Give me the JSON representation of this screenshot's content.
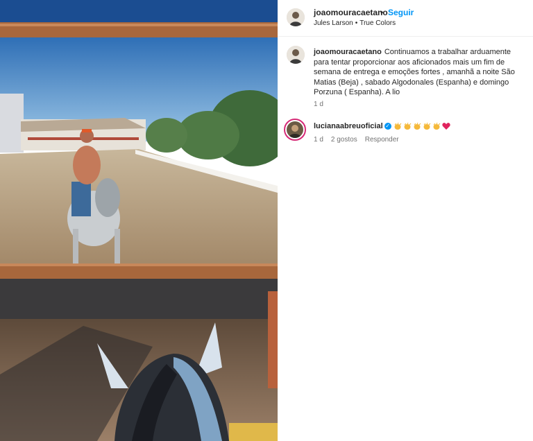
{
  "post": {
    "username": "joaomouracaetano",
    "separator": "•",
    "follow_label": "Seguir",
    "audio_artist": "Jules Larson",
    "audio_separator": "•",
    "audio_track": "True Colors"
  },
  "caption": {
    "username": "joaomouracaetano",
    "text": "Continuamos a trabalhar arduamente para tentar proporcionar aos aficionados mais um fim de semana de entrega e emoções fortes , amanhã a noite São Matias (Beja) , sabado Algodonales (Espanha) e domingo Porzuna ( Espanha). A lio",
    "time": "1 d"
  },
  "comments": [
    {
      "username": "lucianaabreuoficial",
      "verified_mark": "✓",
      "reactions": [
        "clapping-hands",
        "clapping-hands",
        "clapping-hands",
        "clapping-hands",
        "clapping-hands",
        "red-heart"
      ],
      "time": "1 d",
      "likes": "2 gostos",
      "reply_label": "Responder"
    }
  ],
  "colors": {
    "link_blue": "#0095f6",
    "text": "#262626",
    "muted": "#737373",
    "story_ring": "#d62976",
    "heart": "#e0245e"
  }
}
